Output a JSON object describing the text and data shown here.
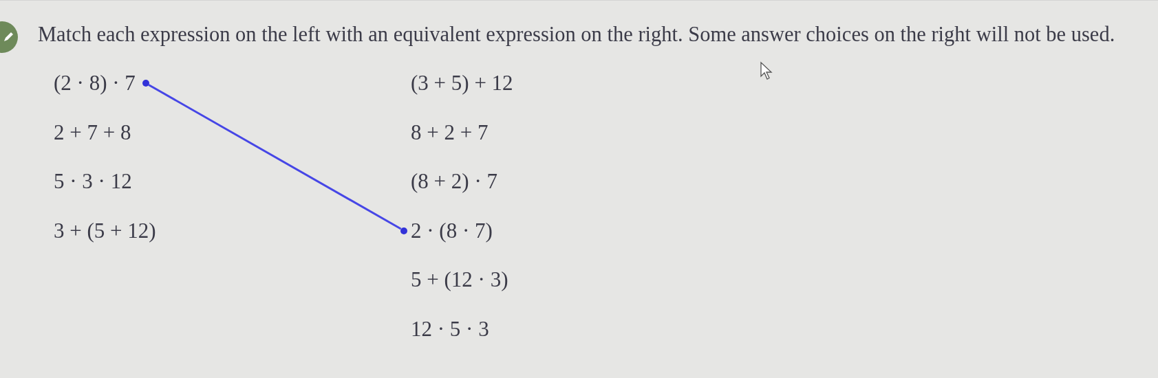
{
  "question": "Match each expression on the left with an equivalent expression on the right. Some answer choices on the right will not be used.",
  "left": [
    {
      "text": "(2 · 8) · 7",
      "connected": true
    },
    {
      "text": "2 + 7 + 8",
      "connected": false
    },
    {
      "text": "5 · 3 · 12",
      "connected": false
    },
    {
      "text": "3 + (5 + 12)",
      "connected": false
    }
  ],
  "right": [
    {
      "text": "(3 + 5) + 12",
      "connected": false
    },
    {
      "text": "8 + 2 + 7",
      "connected": false
    },
    {
      "text": "(8 + 2) · 7",
      "connected": false
    },
    {
      "text": "2 · (8 · 7)",
      "connected": true
    },
    {
      "text": "5 + (12 · 3)",
      "connected": false
    },
    {
      "text": "12 · 5 · 3",
      "connected": false
    }
  ]
}
